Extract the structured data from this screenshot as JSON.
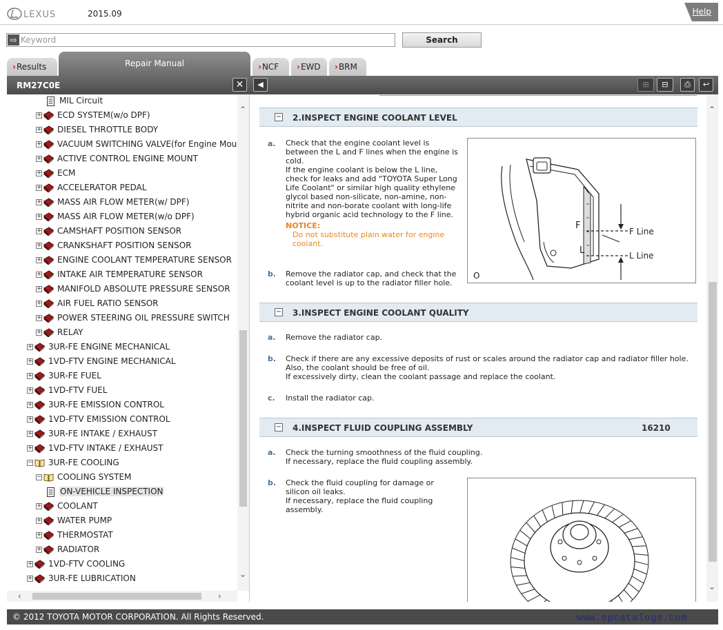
{
  "header": {
    "logo_text": "LEXUS",
    "version": "2015.09",
    "help_label": "Help"
  },
  "search": {
    "placeholder": "Keyword",
    "button_label": "Search"
  },
  "tabs": [
    {
      "label": "Results",
      "active": false
    },
    {
      "label": "Repair Manual",
      "active": true
    },
    {
      "label": "NCF",
      "active": false
    },
    {
      "label": "EWD",
      "active": false
    },
    {
      "label": "BRM",
      "active": false
    }
  ],
  "left_panel": {
    "title": "RM27C0E",
    "close_icon": "close-icon"
  },
  "tree": {
    "items": [
      {
        "label": "MIL Circuit",
        "type": "doc",
        "level": 3,
        "toggle": ""
      },
      {
        "label": "ECD SYSTEM(w/o DPF)",
        "type": "book",
        "level": 2,
        "toggle": "+"
      },
      {
        "label": "DIESEL THROTTLE BODY",
        "type": "book",
        "level": 2,
        "toggle": "+"
      },
      {
        "label": "VACUUM SWITCHING VALVE(for Engine Mount",
        "type": "book",
        "level": 2,
        "toggle": "+"
      },
      {
        "label": "ACTIVE CONTROL ENGINE MOUNT",
        "type": "book",
        "level": 2,
        "toggle": "+"
      },
      {
        "label": "ECM",
        "type": "book",
        "level": 2,
        "toggle": "+"
      },
      {
        "label": "ACCELERATOR PEDAL",
        "type": "book",
        "level": 2,
        "toggle": "+"
      },
      {
        "label": "MASS AIR FLOW METER(w/ DPF)",
        "type": "book",
        "level": 2,
        "toggle": "+"
      },
      {
        "label": "MASS AIR FLOW METER(w/o DPF)",
        "type": "book",
        "level": 2,
        "toggle": "+"
      },
      {
        "label": "CAMSHAFT POSITION SENSOR",
        "type": "book",
        "level": 2,
        "toggle": "+"
      },
      {
        "label": "CRANKSHAFT POSITION SENSOR",
        "type": "book",
        "level": 2,
        "toggle": "+"
      },
      {
        "label": "ENGINE COOLANT TEMPERATURE SENSOR",
        "type": "book",
        "level": 2,
        "toggle": "+"
      },
      {
        "label": "INTAKE AIR TEMPERATURE SENSOR",
        "type": "book",
        "level": 2,
        "toggle": "+"
      },
      {
        "label": "MANIFOLD ABSOLUTE PRESSURE SENSOR",
        "type": "book",
        "level": 2,
        "toggle": "+"
      },
      {
        "label": "AIR FUEL RATIO SENSOR",
        "type": "book",
        "level": 2,
        "toggle": "+"
      },
      {
        "label": "POWER STEERING OIL PRESSURE SWITCH",
        "type": "book",
        "level": 2,
        "toggle": "+"
      },
      {
        "label": "RELAY",
        "type": "book",
        "level": 2,
        "toggle": "+"
      },
      {
        "label": "3UR-FE ENGINE MECHANICAL",
        "type": "book",
        "level": 1,
        "toggle": "+"
      },
      {
        "label": "1VD-FTV ENGINE MECHANICAL",
        "type": "book",
        "level": 1,
        "toggle": "+"
      },
      {
        "label": "3UR-FE FUEL",
        "type": "book",
        "level": 1,
        "toggle": "+"
      },
      {
        "label": "1VD-FTV FUEL",
        "type": "book",
        "level": 1,
        "toggle": "+"
      },
      {
        "label": "3UR-FE EMISSION CONTROL",
        "type": "book",
        "level": 1,
        "toggle": "+"
      },
      {
        "label": "1VD-FTV EMISSION CONTROL",
        "type": "book",
        "level": 1,
        "toggle": "+"
      },
      {
        "label": "3UR-FE INTAKE / EXHAUST",
        "type": "book",
        "level": 1,
        "toggle": "+"
      },
      {
        "label": "1VD-FTV INTAKE / EXHAUST",
        "type": "book",
        "level": 1,
        "toggle": "+"
      },
      {
        "label": "3UR-FE COOLING",
        "type": "open-book",
        "level": 1,
        "toggle": "-"
      },
      {
        "label": "COOLING SYSTEM",
        "type": "open-book",
        "level": 2,
        "toggle": "-"
      },
      {
        "label": "ON-VEHICLE INSPECTION",
        "type": "doc",
        "level": 3,
        "toggle": "",
        "selected": true
      },
      {
        "label": "COOLANT",
        "type": "book",
        "level": 2,
        "toggle": "+"
      },
      {
        "label": "WATER PUMP",
        "type": "book",
        "level": 2,
        "toggle": "+"
      },
      {
        "label": "THERMOSTAT",
        "type": "book",
        "level": 2,
        "toggle": "+"
      },
      {
        "label": "RADIATOR",
        "type": "book",
        "level": 2,
        "toggle": "+"
      },
      {
        "label": "1VD-FTV COOLING",
        "type": "book",
        "level": 1,
        "toggle": "+"
      },
      {
        "label": "3UR-FE LUBRICATION",
        "type": "book",
        "level": 1,
        "toggle": "+"
      }
    ]
  },
  "content": {
    "sections": [
      {
        "title": "2.INSPECT ENGINE COOLANT LEVEL",
        "code": "",
        "steps": [
          {
            "letter": "a.",
            "lines": [
              "Check that the engine coolant level is",
              "between the L and F lines when the engine is",
              "cold.",
              "If the engine coolant is below the L line,",
              "check for leaks and add \"TOYOTA Super Long",
              "Life Coolant\" or similar high quality ethylene",
              "glycol based non-silicate, non-amine, non-",
              "nitrite and non-borate coolant with long-life",
              "hybrid organic acid technology to the F line."
            ]
          },
          {
            "letter": "b.",
            "lines": [
              "Remove the radiator cap, and check that the",
              "coolant level is up to the radiator filler hole."
            ]
          }
        ],
        "notice": {
          "title": "NOTICE:",
          "lines": [
            "Do not substitute plain water for engine",
            "coolant."
          ]
        },
        "figure": {
          "label_f": "F",
          "label_l": "L",
          "f_line": "F Line",
          "l_line": "L Line",
          "corner": "O"
        }
      },
      {
        "title": "3.INSPECT ENGINE COOLANT QUALITY",
        "code": "",
        "steps": [
          {
            "letter": "a.",
            "lines": [
              "Remove the radiator cap."
            ]
          },
          {
            "letter": "b.",
            "lines": [
              "Check if there are any excessive deposits of rust or scales around the radiator cap and radiator filler hole.",
              "Also, the coolant should be free of oil.",
              "If excessively dirty, clean the coolant passage and replace the coolant."
            ]
          },
          {
            "letter": "c.",
            "lines": [
              "Install the radiator cap."
            ]
          }
        ]
      },
      {
        "title": "4.INSPECT FLUID COUPLING ASSEMBLY",
        "code": "16210",
        "steps": [
          {
            "letter": "a.",
            "lines": [
              "Check the turning smoothness of the fluid coupling.",
              "If necessary, replace the fluid coupling assembly."
            ]
          },
          {
            "letter": "b.",
            "lines": [
              "Check the fluid coupling for damage or",
              "silicon oil leaks.",
              "If necessary, replace the fluid coupling",
              "assembly."
            ]
          }
        ]
      }
    ]
  },
  "footer": {
    "copyright": "© 2012 TOYOTA MOTOR CORPORATION. All Rights Reserved.",
    "watermark": "www.epcatalogs.com"
  },
  "colors": {
    "header_dark": "#4b4b4b",
    "section_bg": "#e2ebf1",
    "step_letter": "#4a6e96",
    "notice": "#e8861e",
    "book_icon": "#9c1c1c",
    "tab_chevron": "#cc2200"
  },
  "icons": [
    "close-icon",
    "collapse-panel-icon",
    "expand-all-icon",
    "collapse-all-icon",
    "print-icon",
    "return-icon",
    "search-arrow-icon"
  ]
}
